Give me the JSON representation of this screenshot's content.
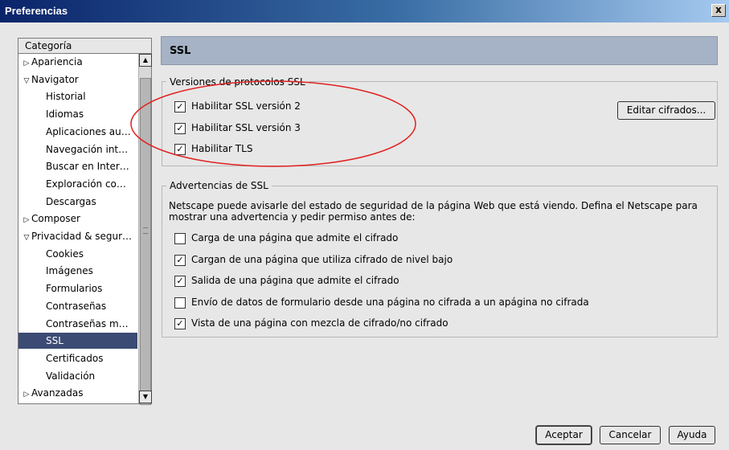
{
  "window": {
    "title": "Preferencias",
    "close_label": "x"
  },
  "category": {
    "header": "Categoría",
    "items": [
      {
        "label": "Apariencia",
        "indent": 0,
        "expander": "right",
        "selected": false
      },
      {
        "label": "Navigator",
        "indent": 0,
        "expander": "down",
        "selected": false
      },
      {
        "label": "Historial",
        "indent": 1,
        "expander": "",
        "selected": false
      },
      {
        "label": "Idiomas",
        "indent": 1,
        "expander": "",
        "selected": false
      },
      {
        "label": "Aplicaciones au…",
        "indent": 1,
        "expander": "",
        "selected": false
      },
      {
        "label": "Navegación int…",
        "indent": 1,
        "expander": "",
        "selected": false
      },
      {
        "label": "Buscar en Inter…",
        "indent": 1,
        "expander": "",
        "selected": false
      },
      {
        "label": "Exploración co…",
        "indent": 1,
        "expander": "",
        "selected": false
      },
      {
        "label": "Descargas",
        "indent": 1,
        "expander": "",
        "selected": false
      },
      {
        "label": "Composer",
        "indent": 0,
        "expander": "right",
        "selected": false
      },
      {
        "label": "Privacidad & segur…",
        "indent": 0,
        "expander": "down",
        "selected": false
      },
      {
        "label": "Cookies",
        "indent": 1,
        "expander": "",
        "selected": false
      },
      {
        "label": "Imágenes",
        "indent": 1,
        "expander": "",
        "selected": false
      },
      {
        "label": "Formularios",
        "indent": 1,
        "expander": "",
        "selected": false
      },
      {
        "label": "Contraseñas",
        "indent": 1,
        "expander": "",
        "selected": false
      },
      {
        "label": "Contraseñas m…",
        "indent": 1,
        "expander": "",
        "selected": false
      },
      {
        "label": "SSL",
        "indent": 1,
        "expander": "",
        "selected": true
      },
      {
        "label": "Certificados",
        "indent": 1,
        "expander": "",
        "selected": false
      },
      {
        "label": "Validación",
        "indent": 1,
        "expander": "",
        "selected": false
      },
      {
        "label": "Avanzadas",
        "indent": 0,
        "expander": "right",
        "selected": false
      }
    ]
  },
  "panel": {
    "title": "SSL"
  },
  "versions": {
    "legend": "Versiones de protocolos SSL",
    "items": [
      {
        "label": "Habilitar SSL versión 2",
        "checked": true
      },
      {
        "label": "Habilitar SSL versión 3",
        "checked": true
      },
      {
        "label": "Habilitar TLS",
        "checked": true
      }
    ],
    "edit_button": "Editar cifrados..."
  },
  "warnings": {
    "legend": "Advertencias de SSL",
    "description_line1": "Netscape puede avisarle del estado de seguridad de la página Web que está viendo. Defina el Netscape para",
    "description_line2": "mostrar una advertencia y pedir permiso antes de:",
    "items": [
      {
        "label": "Carga de una página que admite el cifrado",
        "checked": false
      },
      {
        "label": "Cargan de una página que utiliza cifrado de nivel bajo",
        "checked": true
      },
      {
        "label": "Salida de una página que admite el cifrado",
        "checked": true
      },
      {
        "label": "Envío de datos de formulario desde una página no cifrada a un apágina no cifrada",
        "checked": false
      },
      {
        "label": "Vista de una página con mezcla de cifrado/no cifrado",
        "checked": true
      }
    ]
  },
  "buttons": {
    "ok": "Aceptar",
    "cancel": "Cancelar",
    "help": "Ayuda"
  },
  "colors": {
    "selection": "#3c4b73",
    "header": "#a6b3c6",
    "annotation": "#e02020"
  }
}
